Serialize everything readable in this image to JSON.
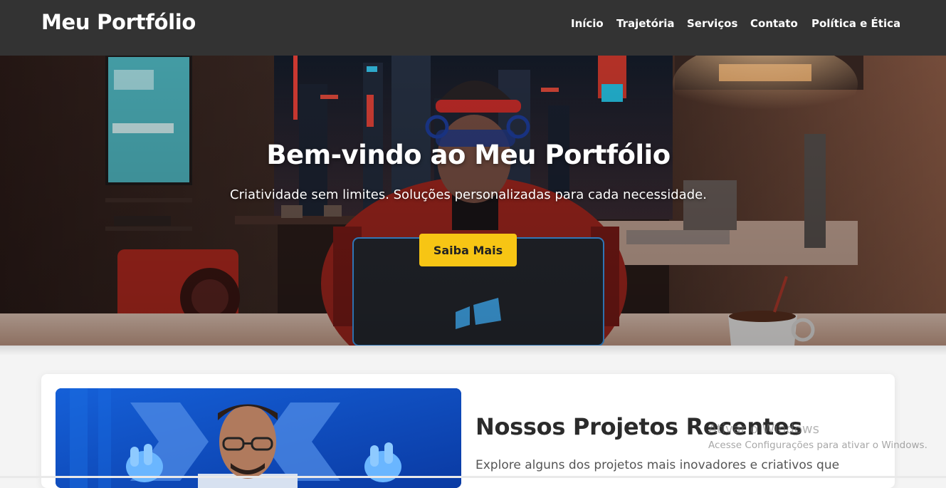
{
  "header": {
    "brand": "Meu Portfólio",
    "nav": [
      "Início",
      "Trajetória",
      "Serviços",
      "Contato",
      "Política e Ética"
    ]
  },
  "hero": {
    "title": "Bem-vindo ao Meu Portfólio",
    "subtitle": "Criatividade sem limites. Soluções personalizadas para cada necessidade.",
    "cta_label": "Saiba Mais"
  },
  "projects": {
    "title": "Nossos Projetos Recentes",
    "text": "Explore alguns dos projetos mais inovadores e criativos que"
  },
  "watermark": {
    "title": "Ativar o Windows",
    "subtitle": "Acesse Configurações para ativar o Windows."
  },
  "colors": {
    "header_bg": "#333333",
    "accent": "#f7c514",
    "page_bg": "#f4f4f4"
  }
}
